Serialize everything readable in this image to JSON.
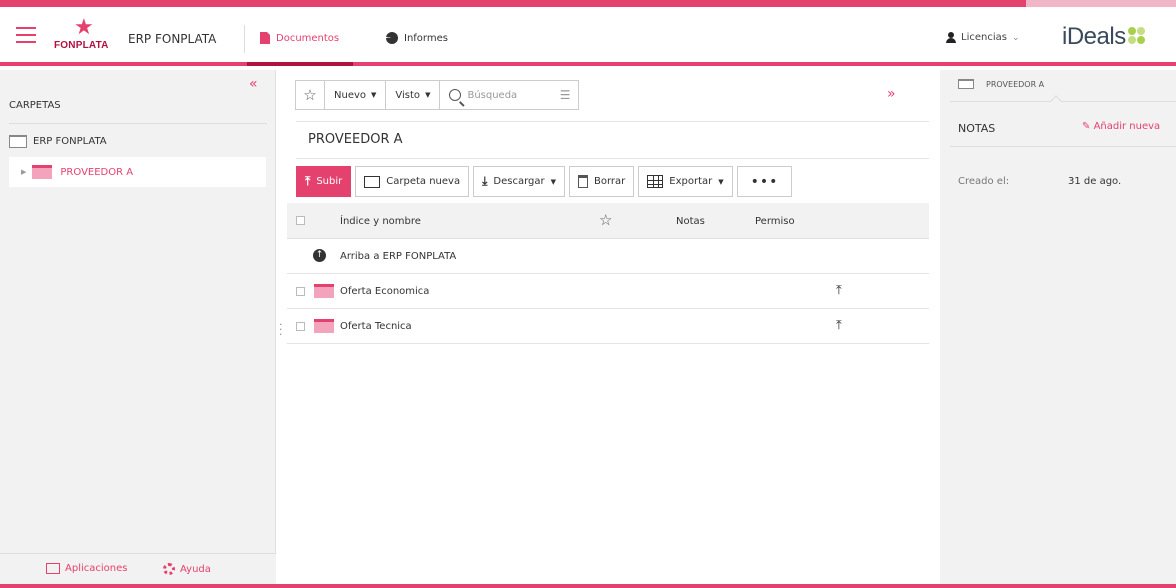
{
  "header": {
    "brand_word": "FONPLATA",
    "project_name": "ERP FONPLATA",
    "nav": {
      "documentos": "Documentos",
      "informes": "Informes"
    },
    "licencias": "Licencias",
    "ideals_logo": "iDeals"
  },
  "sidebar": {
    "title": "CARPETAS",
    "tree": [
      {
        "label": "ERP FONPLATA"
      },
      {
        "label": "PROVEEDOR A"
      }
    ],
    "footer": {
      "aplicaciones": "Aplicaciones",
      "ayuda": "Ayuda"
    }
  },
  "toolbar": {
    "nuevo": "Nuevo",
    "visto": "Visto",
    "search_placeholder": "Búsqueda"
  },
  "main": {
    "folder_title": "PROVEEDOR A",
    "actions": {
      "subir": "Subir",
      "carpeta_nueva": "Carpeta nueva",
      "descargar": "Descargar",
      "borrar": "Borrar",
      "exportar": "Exportar"
    },
    "table": {
      "headers": {
        "name": "Índice y nombre",
        "notas": "Notas",
        "permiso": "Permiso"
      },
      "up_row": "Arriba a ERP FONPLATA",
      "rows": [
        {
          "name": "Oferta Economica"
        },
        {
          "name": "Oferta Tecnica"
        }
      ]
    }
  },
  "right_panel": {
    "tab": "PROVEEDOR A",
    "notas": "NOTAS",
    "add_note": "Añadir nueva",
    "created_label": "Creado el:",
    "created_value": "31 de ago."
  },
  "colors": {
    "accent": "#e5416f",
    "accent_dark": "#b0123f",
    "ideals_green": "#a8d04c"
  }
}
